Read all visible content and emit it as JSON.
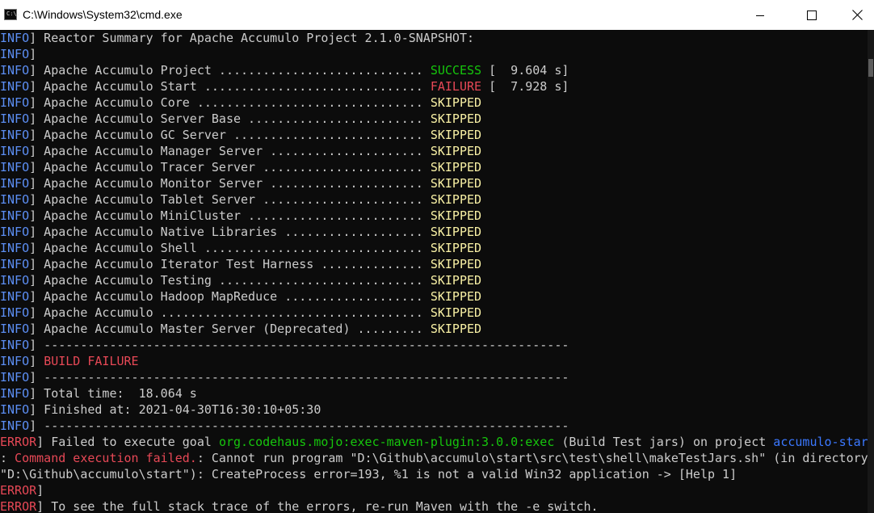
{
  "window": {
    "title": "C:\\Windows\\System32\\cmd.exe",
    "icon_label": "C:\\.",
    "controls": {
      "minimize": "minimize-icon",
      "maximize": "maximize-icon",
      "close": "close-icon"
    }
  },
  "colors": {
    "background": "#0c0c0c",
    "text": "#cccccc",
    "info_tag": "#5c8ef3",
    "error_tag": "#e74856",
    "success": "#16c60c",
    "failure": "#e74856",
    "skipped": "#f9f1a5",
    "link_blue": "#3b78ff"
  },
  "console": {
    "lines": [
      {
        "level": "INFO",
        "text": " Reactor Summary for Apache Accumulo Project 2.1.0-SNAPSHOT:"
      },
      {
        "level": "INFO",
        "text": ""
      },
      {
        "level": "INFO",
        "text": " Apache Accumulo Project ............................ ",
        "status": "SUCCESS",
        "time": " [  9.604 s]"
      },
      {
        "level": "INFO",
        "text": " Apache Accumulo Start .............................. ",
        "status": "FAILURE",
        "time": " [  7.928 s]"
      },
      {
        "level": "INFO",
        "text": " Apache Accumulo Core ............................... ",
        "status": "SKIPPED"
      },
      {
        "level": "INFO",
        "text": " Apache Accumulo Server Base ........................ ",
        "status": "SKIPPED"
      },
      {
        "level": "INFO",
        "text": " Apache Accumulo GC Server .......................... ",
        "status": "SKIPPED"
      },
      {
        "level": "INFO",
        "text": " Apache Accumulo Manager Server ..................... ",
        "status": "SKIPPED"
      },
      {
        "level": "INFO",
        "text": " Apache Accumulo Tracer Server ...................... ",
        "status": "SKIPPED"
      },
      {
        "level": "INFO",
        "text": " Apache Accumulo Monitor Server ..................... ",
        "status": "SKIPPED"
      },
      {
        "level": "INFO",
        "text": " Apache Accumulo Tablet Server ...................... ",
        "status": "SKIPPED"
      },
      {
        "level": "INFO",
        "text": " Apache Accumulo MiniCluster ........................ ",
        "status": "SKIPPED"
      },
      {
        "level": "INFO",
        "text": " Apache Accumulo Native Libraries ................... ",
        "status": "SKIPPED"
      },
      {
        "level": "INFO",
        "text": " Apache Accumulo Shell .............................. ",
        "status": "SKIPPED"
      },
      {
        "level": "INFO",
        "text": " Apache Accumulo Iterator Test Harness .............. ",
        "status": "SKIPPED"
      },
      {
        "level": "INFO",
        "text": " Apache Accumulo Testing ............................ ",
        "status": "SKIPPED"
      },
      {
        "level": "INFO",
        "text": " Apache Accumulo Hadoop MapReduce ................... ",
        "status": "SKIPPED"
      },
      {
        "level": "INFO",
        "text": " Apache Accumulo .................................... ",
        "status": "SKIPPED"
      },
      {
        "level": "INFO",
        "text": " Apache Accumulo Master Server (Deprecated) ......... ",
        "status": "SKIPPED"
      },
      {
        "level": "INFO",
        "text": " ------------------------------------------------------------------------"
      },
      {
        "level": "INFO",
        "text": " ",
        "status": "BUILD FAILURE"
      },
      {
        "level": "INFO",
        "text": " ------------------------------------------------------------------------"
      },
      {
        "level": "INFO",
        "text": " Total time:  18.064 s"
      },
      {
        "level": "INFO",
        "text": " Finished at: 2021-04-30T16:30:10+05:30"
      },
      {
        "level": "INFO",
        "text": " ------------------------------------------------------------------------"
      },
      {
        "level": "ERROR",
        "text": " Failed to execute goal ",
        "goal": "org.codehaus.mojo:exec-maven-plugin:3.0.0:exec",
        "tail": " (Build Test jars) on project ",
        "project": "accumulo-start"
      },
      {
        "prefix": ":",
        "highlight": " Command execution failed.",
        "tail": ": Cannot run program \"D:\\Github\\accumulo\\start\\src\\test\\shell\\makeTestJars.sh\" (in directory"
      },
      {
        "text": "\"D:\\Github\\accumulo\\start\"): CreateProcess error=193, %1 is not a valid Win32 application -> [Help 1]"
      },
      {
        "level": "ERROR",
        "text": ""
      },
      {
        "level": "ERROR",
        "text": " To see the full stack trace of the errors, re-run Maven with the -e switch."
      }
    ]
  }
}
